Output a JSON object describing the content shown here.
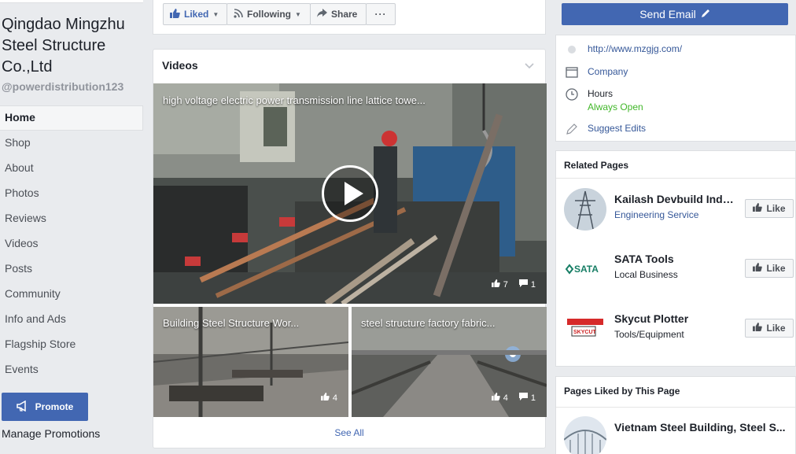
{
  "page": {
    "name": "Qingdao Mingzhu Steel Structure Co.,Ltd",
    "handle": "@powerdistribution123"
  },
  "nav": {
    "items": [
      "Home",
      "Shop",
      "About",
      "Photos",
      "Reviews",
      "Videos",
      "Posts",
      "Community",
      "Info and Ads",
      "Flagship Store",
      "Events"
    ],
    "active": "Home"
  },
  "promote": {
    "button_label": "Promote",
    "manage_label": "Manage Promotions"
  },
  "actions": {
    "liked_label": "Liked",
    "following_label": "Following",
    "share_label": "Share",
    "more_label": "···"
  },
  "videos": {
    "title": "Videos",
    "main": {
      "title": "high voltage electric power transmission line lattice towe...",
      "likes": "7",
      "comments": "1"
    },
    "thumbs": [
      {
        "title": "Building Steel Structure Wor...",
        "likes": "4"
      },
      {
        "title": "steel structure factory fabric...",
        "likes": "4",
        "comments": "1"
      }
    ],
    "see_all": "See All"
  },
  "sidebar_right": {
    "send_email_label": "Send Email",
    "website": "http://www.mzgjg.com/",
    "category": "Company",
    "hours_label": "Hours",
    "hours_status": "Always Open",
    "suggest_edits": "Suggest Edits"
  },
  "related_pages": {
    "title": "Related Pages",
    "like_label": "Like",
    "items": [
      {
        "name": "Kailash Devbuild Indi...",
        "category": "Engineering Service"
      },
      {
        "name": "SATA Tools",
        "category": "Local Business",
        "logo_text": "SATA"
      },
      {
        "name": "Skycut Plotter",
        "category": "Tools/Equipment",
        "logo_text": "SKYCUT"
      }
    ]
  },
  "pages_liked": {
    "title": "Pages Liked by This Page",
    "items": [
      {
        "name": "Vietnam Steel Building, Steel S..."
      }
    ]
  },
  "colors": {
    "brand_blue": "#4267b2",
    "link_blue": "#365899",
    "open_green": "#42b72a",
    "page_bg": "#e9ebee"
  }
}
